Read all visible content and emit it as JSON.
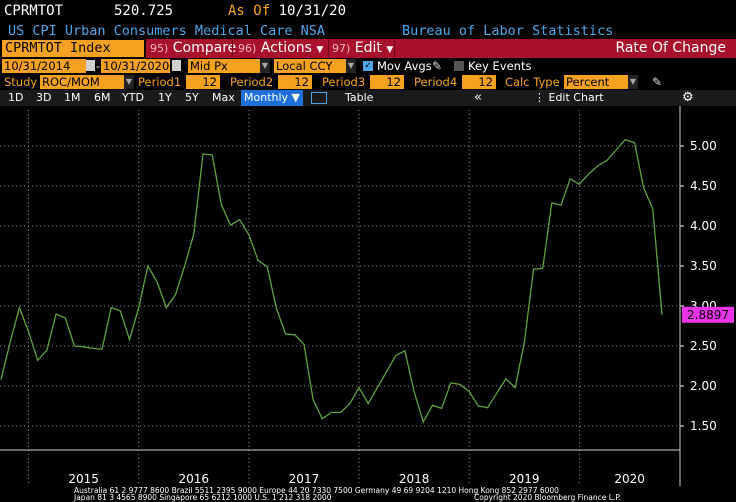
{
  "header": {
    "ticker": "CPRMTOT",
    "price": "520.725",
    "as_of_label": "As Of",
    "as_of_date": "10/31/20",
    "description": "US CPI Urban Consumers Medical Care NSA",
    "source": "Bureau of Labor Statistics"
  },
  "command_bar": {
    "security": "CPRMTOT Index",
    "compare": {
      "num": "95)",
      "label": "Compare"
    },
    "actions": {
      "num": "96)",
      "label": "Actions"
    },
    "edit": {
      "num": "97)",
      "label": "Edit"
    },
    "mode": "Rate Of Change"
  },
  "options": {
    "start_date": "10/31/2014",
    "end_date": "10/31/2020",
    "price_field": "Mid Px",
    "currency": "Local CCY",
    "mov_avgs_label": "Mov Avgs",
    "mov_avgs_checked": true,
    "key_events_label": "Key Events",
    "key_events_checked": false
  },
  "study": {
    "label": "Study",
    "value": "ROC/MOM",
    "period1_label": "Period1",
    "period1": "12",
    "period2_label": "Period2",
    "period2": "12",
    "period3_label": "Period3",
    "period3": "12",
    "period4_label": "Period4",
    "period4": "12",
    "calc_type_label": "Calc Type",
    "calc_type": "Percent"
  },
  "toolbar": {
    "ranges": [
      "1D",
      "3D",
      "1M",
      "6M",
      "YTD",
      "1Y",
      "5Y",
      "Max"
    ],
    "frequency": "Monthly",
    "table_label": "Table",
    "edit_chart_label": "Edit Chart"
  },
  "colors": {
    "line": "#5fa13f",
    "last_value_tag": "#e833e8",
    "accent_orange": "#f6a120",
    "bar_red": "#a8102b"
  },
  "chart_data": {
    "type": "line",
    "title": "",
    "xlabel": "",
    "ylabel": "",
    "x_ticks": [
      "2015",
      "2016",
      "2017",
      "2018",
      "2019",
      "2020"
    ],
    "y_ticks": [
      "1.50",
      "2.00",
      "2.50",
      "3.00",
      "3.50",
      "4.00",
      "4.50",
      "5.00"
    ],
    "ylim": [
      1.2,
      5.45
    ],
    "y_axis_position": "right",
    "last_value_label": "2.8897",
    "series": [
      {
        "x": [
          "2014-10",
          "2014-11",
          "2014-12",
          "2015-01",
          "2015-02",
          "2015-03",
          "2015-04",
          "2015-05",
          "2015-06",
          "2015-07",
          "2015-08",
          "2015-09",
          "2015-10",
          "2015-11",
          "2015-12",
          "2016-01",
          "2016-02",
          "2016-03",
          "2016-04",
          "2016-05",
          "2016-06",
          "2016-07",
          "2016-08",
          "2016-09",
          "2016-10",
          "2016-11",
          "2016-12",
          "2017-01",
          "2017-02",
          "2017-03",
          "2017-04",
          "2017-05",
          "2017-06",
          "2017-07",
          "2017-08",
          "2017-09",
          "2017-10",
          "2017-11",
          "2017-12",
          "2018-01",
          "2018-02",
          "2018-03",
          "2018-04",
          "2018-05",
          "2018-06",
          "2018-07",
          "2018-08",
          "2018-09",
          "2018-10",
          "2018-11",
          "2018-12",
          "2019-01",
          "2019-02",
          "2019-03",
          "2019-04",
          "2019-05",
          "2019-06",
          "2019-07",
          "2019-08",
          "2019-09",
          "2019-10",
          "2019-11",
          "2019-12",
          "2020-01",
          "2020-02",
          "2020-03",
          "2020-04",
          "2020-05",
          "2020-06",
          "2020-07",
          "2020-08",
          "2020-09",
          "2020-10"
        ],
        "values": [
          2.08,
          2.55,
          2.98,
          2.68,
          2.32,
          2.45,
          2.9,
          2.85,
          2.5,
          2.49,
          2.47,
          2.46,
          2.98,
          2.94,
          2.58,
          2.98,
          3.5,
          3.3,
          2.98,
          3.14,
          3.5,
          3.9,
          4.9,
          4.89,
          4.27,
          4.01,
          4.08,
          3.89,
          3.57,
          3.49,
          2.97,
          2.65,
          2.64,
          2.52,
          1.83,
          1.59,
          1.67,
          1.67,
          1.78,
          1.98,
          1.78,
          1.98,
          2.18,
          2.38,
          2.44,
          1.93,
          1.55,
          1.76,
          1.72,
          2.04,
          2.02,
          1.93,
          1.75,
          1.73,
          1.91,
          2.09,
          1.98,
          2.54,
          3.46,
          3.47,
          4.29,
          4.26,
          4.59,
          4.52,
          4.65,
          4.75,
          4.82,
          4.95,
          5.08,
          5.04,
          4.48,
          4.21,
          2.89
        ]
      }
    ]
  },
  "footer": {
    "line1": "Australia 61 2 9777 8600 Brazil 5511 2395 9000 Europe 44 20 7330 7500 Germany 49 69 9204 1210 Hong Kong 852 2977 6000",
    "line2": "Japan 81 3 4565 8900        Singapore 65 6212 1000        U.S. 1 212 318 2000",
    "copyright": "Copyright 2020 Bloomberg Finance L.P."
  }
}
